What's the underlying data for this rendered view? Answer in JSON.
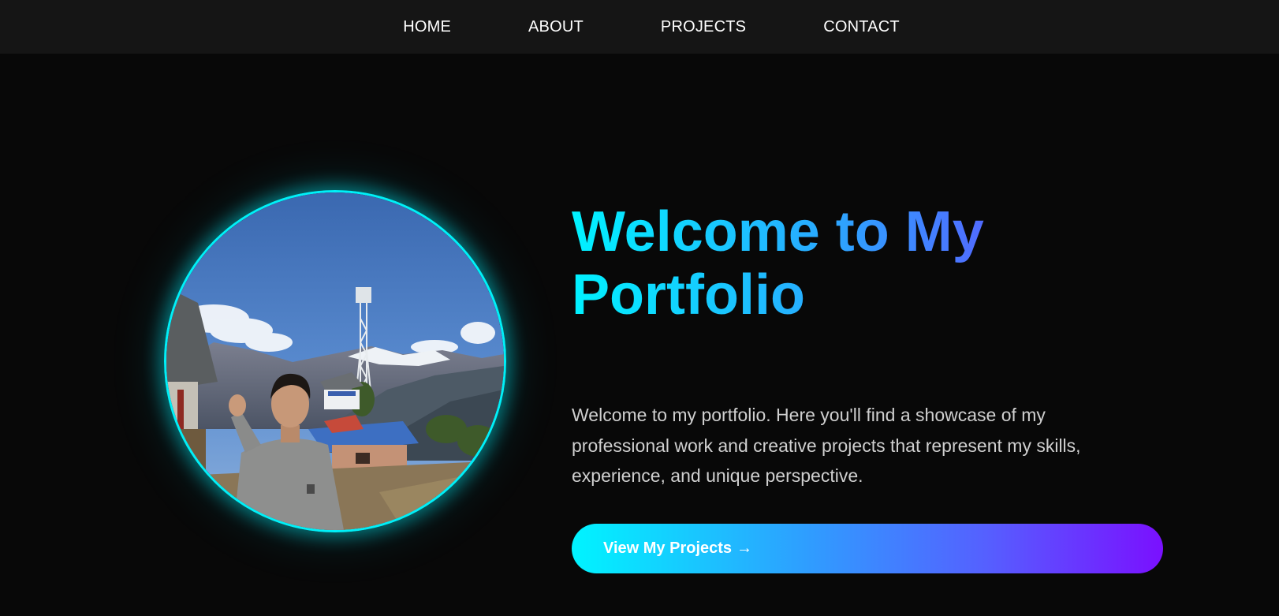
{
  "nav": {
    "items": [
      {
        "label": "HOME"
      },
      {
        "label": "ABOUT"
      },
      {
        "label": "PROJECTS"
      },
      {
        "label": "CONTACT"
      }
    ]
  },
  "hero": {
    "headline": "Welcome to My Portfolio",
    "intro": "Welcome to my portfolio. Here you'll find a showcase of my professional work and creative projects that represent my skills, experience, and unique perspective.",
    "cta_label": "View My Projects",
    "cta_icon": "→"
  },
  "colors": {
    "background": "#080808",
    "navbar": "#151515",
    "accent_cyan": "#00f0f8",
    "accent_purple": "#7a10ff",
    "body_text": "#cfcfcf"
  }
}
